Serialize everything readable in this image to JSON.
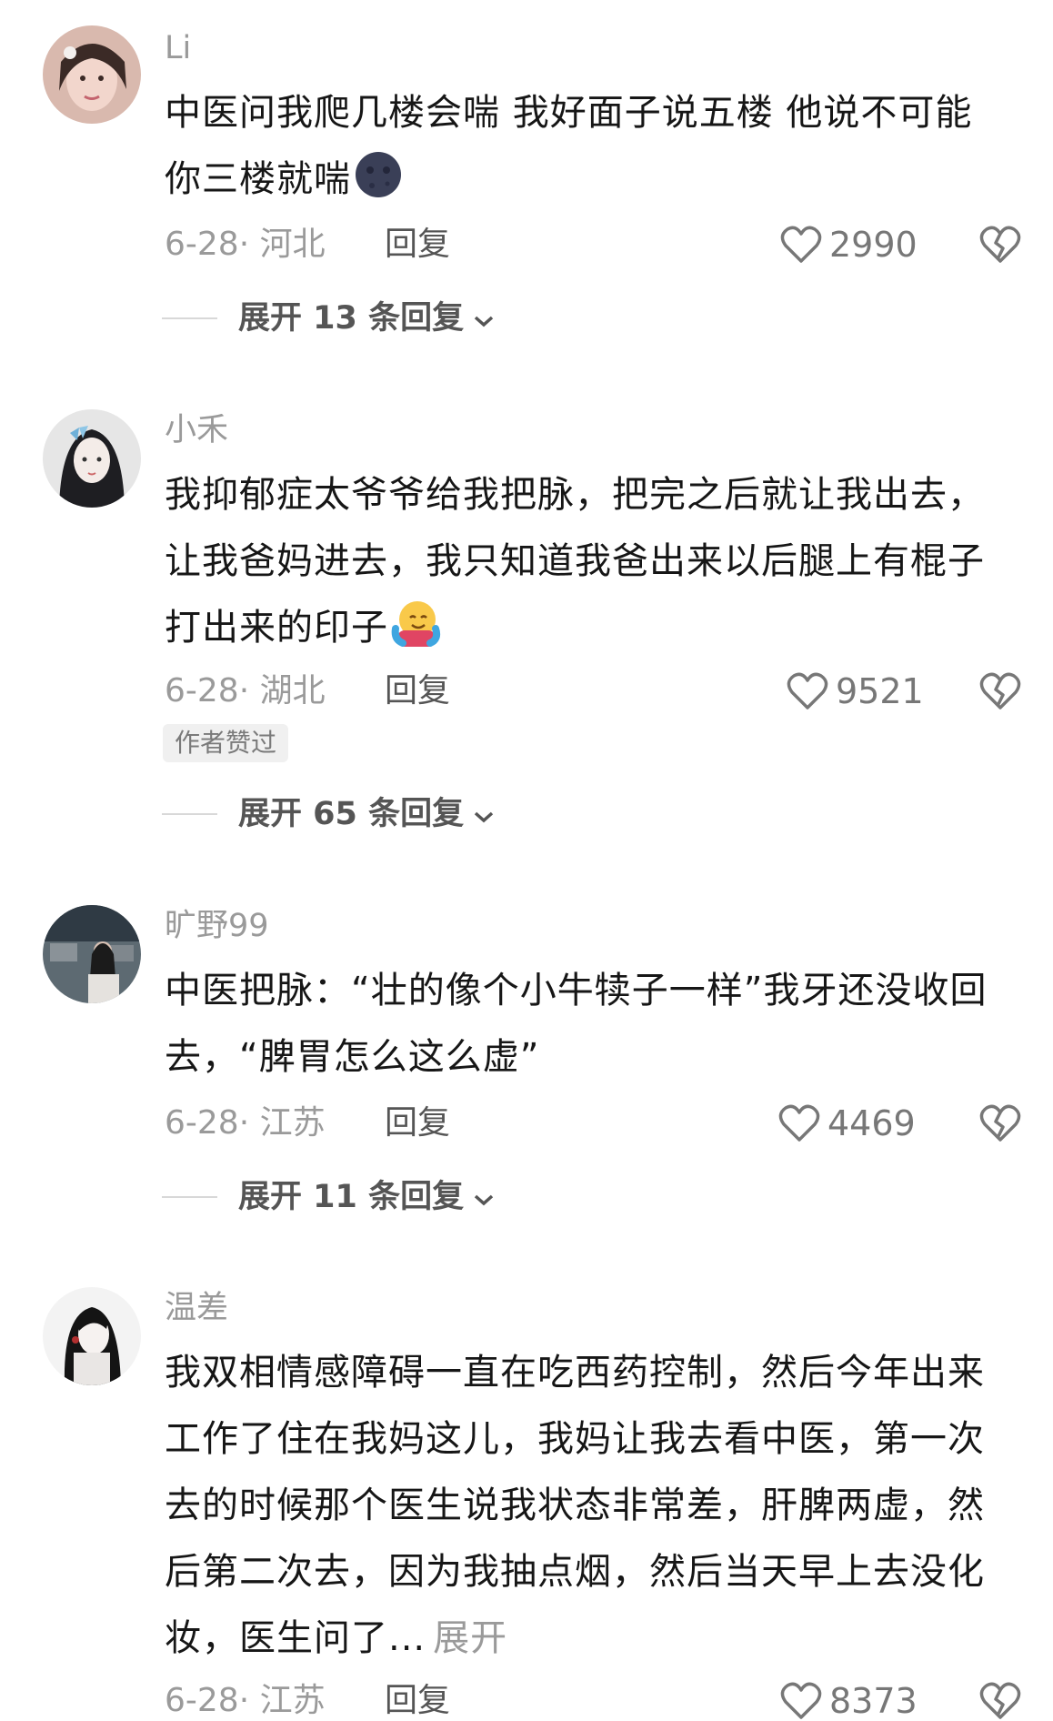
{
  "comments": [
    {
      "username": "Li",
      "text": "中医问我爬几楼会喘 我好面子说五楼  他说不可能 你三楼就喘",
      "emoji": "new-moon-face",
      "date_location": "6-28· 河北",
      "reply_label": "回复",
      "likes": "2990",
      "badge": "",
      "expand_label": "展开 13 条回复"
    },
    {
      "username": "小禾",
      "text": "我抑郁症太爷爷给我把脉，把完之后就让我出去，让我爸妈进去，我只知道我爸出来以后腿上有棍子打出来的印子",
      "emoji": "hugging-face",
      "date_location": "6-28· 湖北",
      "reply_label": "回复",
      "likes": "9521",
      "badge": "作者赞过",
      "expand_label": "展开 65 条回复"
    },
    {
      "username": "旷野99",
      "text": "中医把脉：“壮的像个小牛犊子一样”我牙还没收回去，“脾胃怎么这么虚”",
      "emoji": "",
      "date_location": "6-28· 江苏",
      "reply_label": "回复",
      "likes": "4469",
      "badge": "",
      "expand_label": "展开 11 条回复"
    },
    {
      "username": "温差",
      "text": "我双相情感障碍一直在吃西药控制，然后今年出来工作了住在我妈这儿，我妈让我去看中医，第一次去的时候那个医生说我状态非常差，肝脾两虚，然后第二次去，因为我抽点烟，然后当天早上去没化妆，医生问了...",
      "expand_inline": "展开",
      "emoji": "",
      "date_location": "6-28· 江苏",
      "reply_label": "回复",
      "likes": "8373",
      "badge": "",
      "expand_label": ""
    }
  ],
  "icons": {
    "like": "heart-outline-icon",
    "dislike": "broken-heart-icon",
    "expand": "chevron-down-icon"
  },
  "colors": {
    "text": "#161616",
    "muted": "#9a9a9a",
    "badge_bg": "#f0f0f0"
  }
}
